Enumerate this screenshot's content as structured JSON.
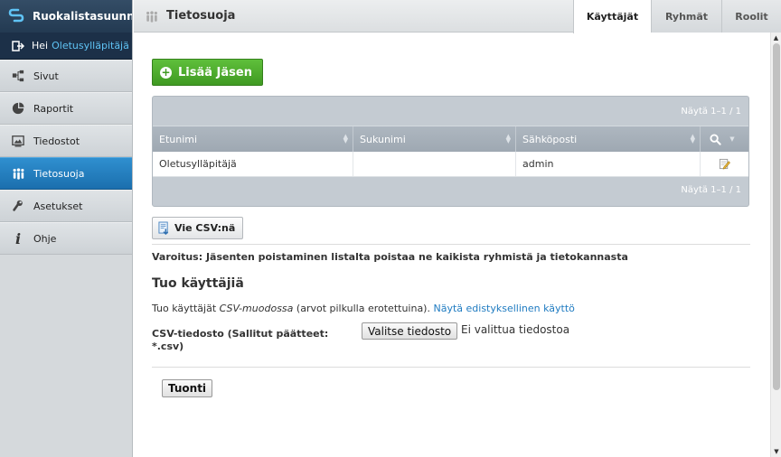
{
  "app": {
    "name": "Ruokalistasuunni"
  },
  "user": {
    "greeting": "Hei",
    "name": "Oletusylläpitäjä"
  },
  "sidebar": {
    "items": [
      {
        "label": "Sivut",
        "icon": "sitemap-icon"
      },
      {
        "label": "Raportit",
        "icon": "pie-chart-icon"
      },
      {
        "label": "Tiedostot",
        "icon": "image-icon"
      },
      {
        "label": "Tietosuoja",
        "icon": "people-icon",
        "active": true
      },
      {
        "label": "Asetukset",
        "icon": "wrench-icon"
      },
      {
        "label": "Ohje",
        "icon": "info-icon"
      }
    ]
  },
  "header": {
    "title": "Tietosuoja",
    "tabs": [
      {
        "label": "Käyttäjät",
        "active": true
      },
      {
        "label": "Ryhmät"
      },
      {
        "label": "Roolit"
      }
    ]
  },
  "members": {
    "add_label": "Lisää Jäsen",
    "pager_top": "Näytä 1–1 / 1",
    "pager_bottom": "Näytä 1–1 / 1",
    "columns": [
      "Etunimi",
      "Sukunimi",
      "Sähköposti"
    ],
    "rows": [
      {
        "first": "Oletusylläpitäjä",
        "last": "",
        "email": "admin"
      }
    ],
    "export_label": "Vie CSV:nä",
    "warning": "Varoitus: Jäsenten poistaminen listalta poistaa ne kaikista ryhmistä ja tietokannasta"
  },
  "import": {
    "title": "Tuo käyttäjiä",
    "desc_prefix": "Tuo käyttäjät",
    "desc_em": "CSV-muodossa",
    "desc_suffix": "(arvot pilkulla erotettuina).",
    "advanced_link": "Näytä edistyksellinen käyttö",
    "file_label": "CSV-tiedosto (Sallitut päätteet: *.csv)",
    "file_button": "Valitse tiedosto",
    "file_status": "Ei valittua tiedostoa",
    "submit_label": "Tuonti"
  },
  "colors": {
    "accent": "#1b6fae",
    "add_button": "#4aa82c",
    "link": "#1f7bc1"
  }
}
